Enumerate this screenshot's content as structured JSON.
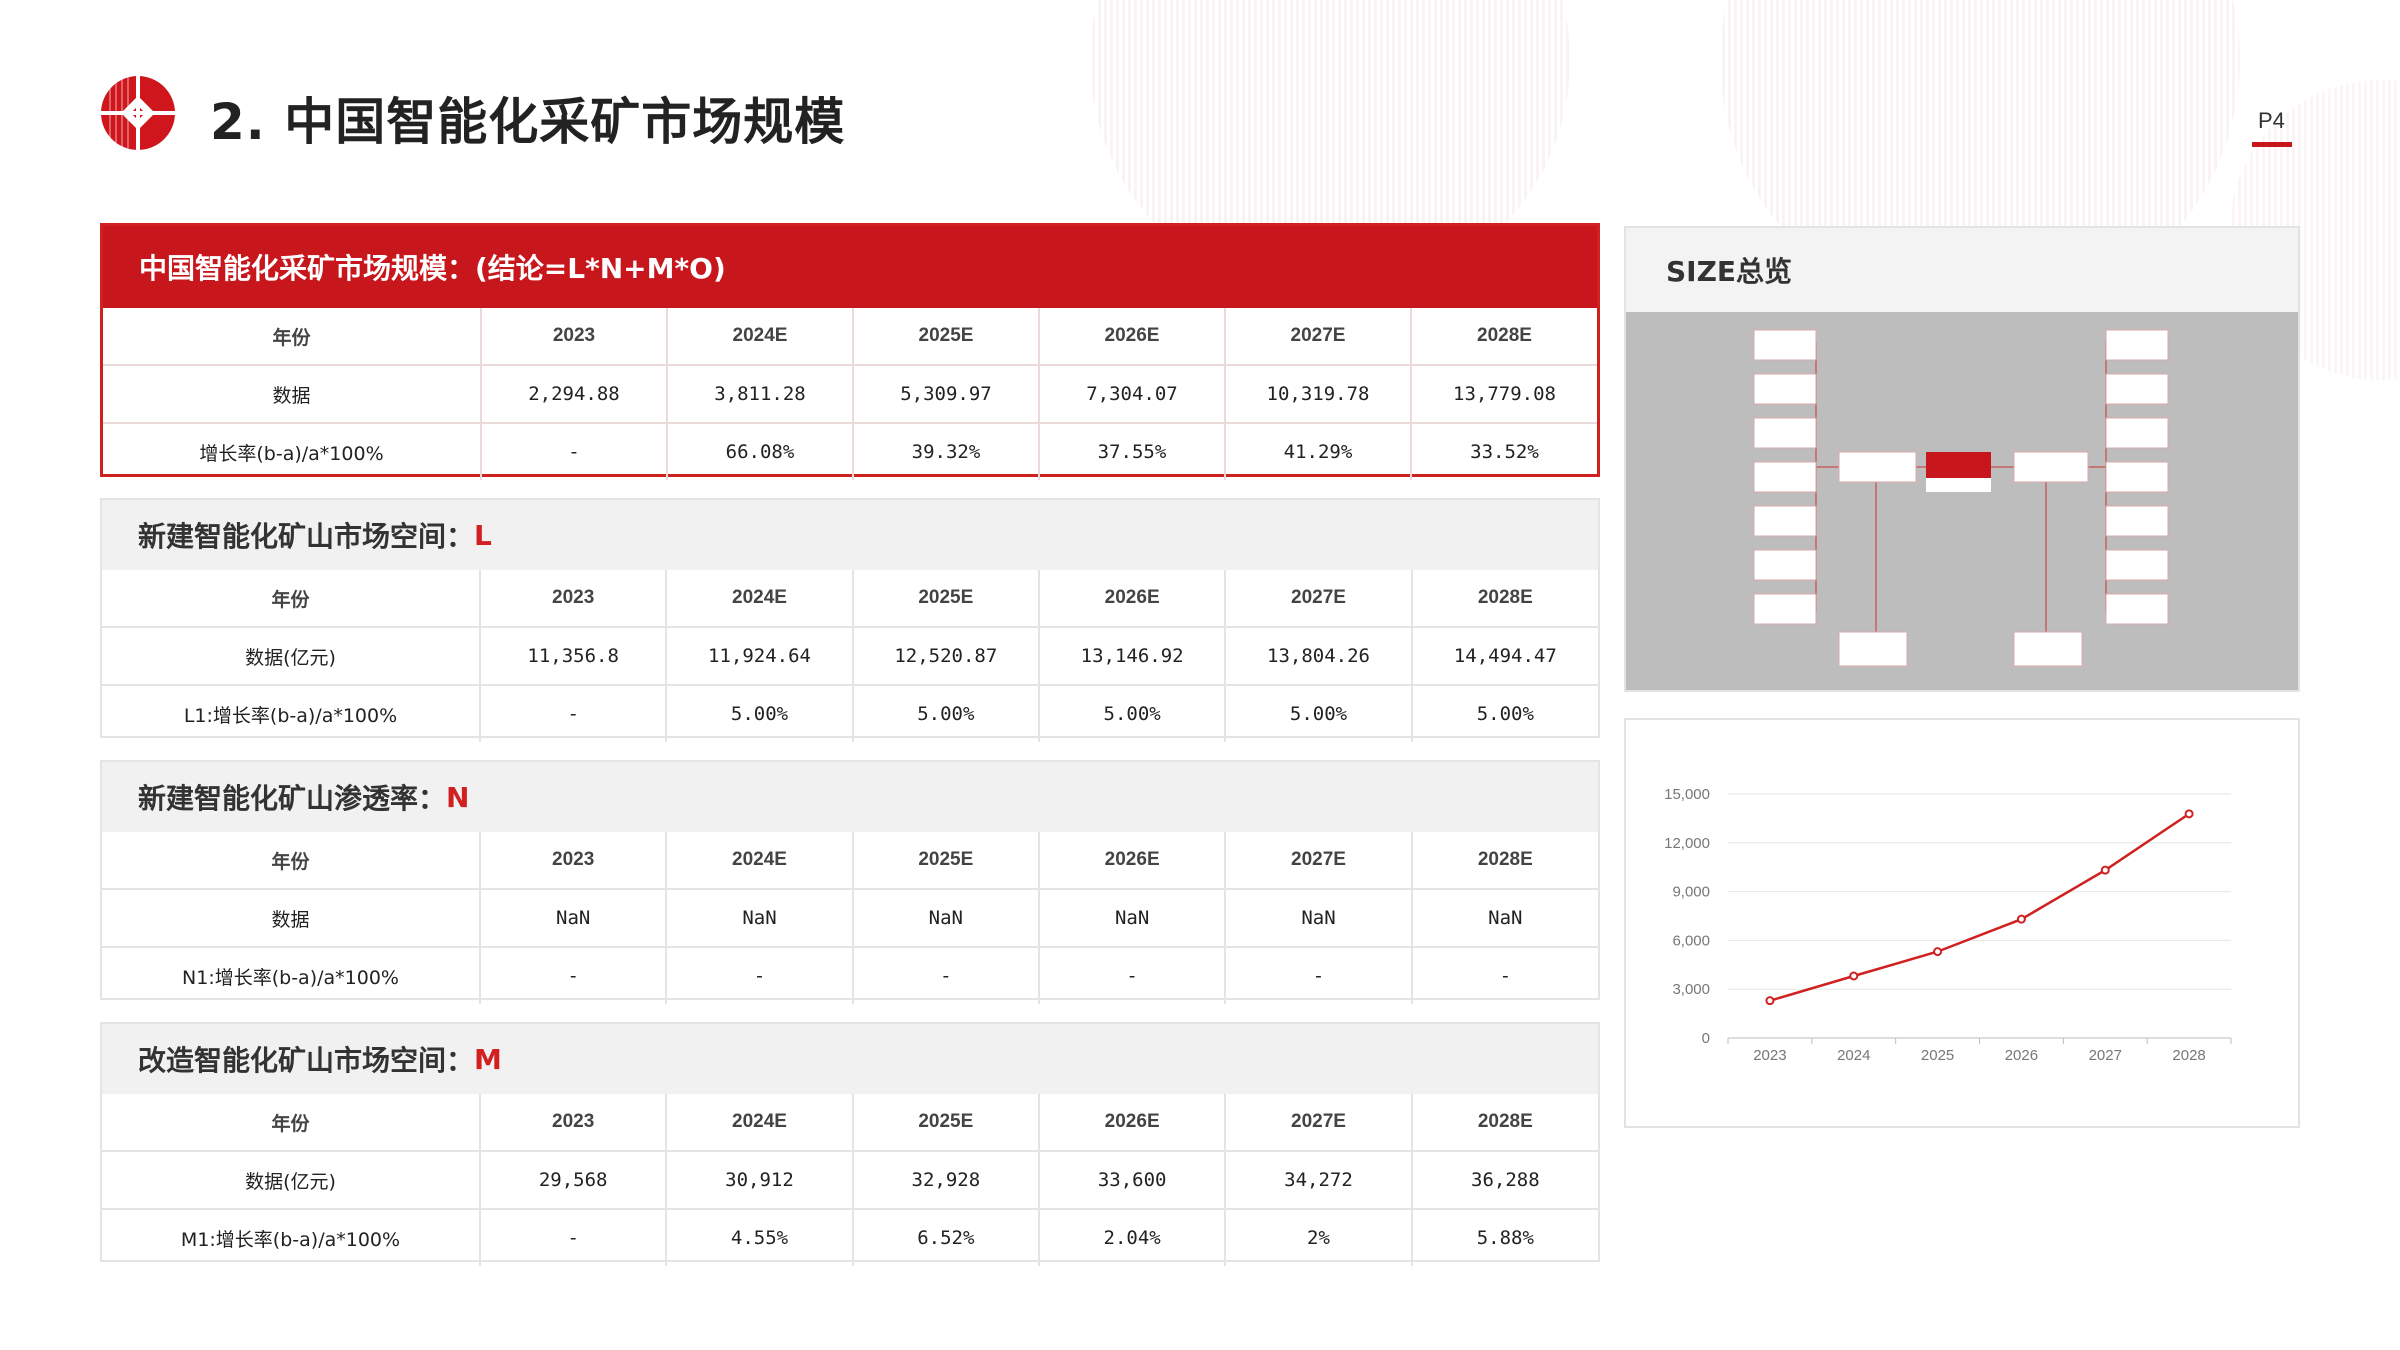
{
  "header": {
    "title": "2.  中国智能化采矿市场规模",
    "page": "P4"
  },
  "colors": {
    "accent": "#c8161d",
    "header_gray": "#f1f1f1",
    "tree_bg": "#bdbdbd"
  },
  "sections": [
    {
      "title": "中国智能化采矿市场规模：(结论=L*N+M*O)",
      "title_accent": "",
      "rows": [
        [
          "年份",
          "2023",
          "2024E",
          "2025E",
          "2026E",
          "2027E",
          "2028E"
        ],
        [
          "数据",
          "2,294.88",
          "3,811.28",
          "5,309.97",
          "7,304.07",
          "10,319.78",
          "13,779.08"
        ],
        [
          "增长率(b-a)/a*100%",
          "-",
          "66.08%",
          "39.32%",
          "37.55%",
          "41.29%",
          "33.52%"
        ]
      ]
    },
    {
      "title": "新建智能化矿山市场空间：",
      "title_accent": "L",
      "rows": [
        [
          "年份",
          "2023",
          "2024E",
          "2025E",
          "2026E",
          "2027E",
          "2028E"
        ],
        [
          "数据(亿元)",
          "11,356.8",
          "11,924.64",
          "12,520.87",
          "13,146.92",
          "13,804.26",
          "14,494.47"
        ],
        [
          "L1:增长率(b-a)/a*100%",
          "-",
          "5.00%",
          "5.00%",
          "5.00%",
          "5.00%",
          "5.00%"
        ]
      ]
    },
    {
      "title": "新建智能化矿山渗透率：",
      "title_accent": "N",
      "rows": [
        [
          "年份",
          "2023",
          "2024E",
          "2025E",
          "2026E",
          "2027E",
          "2028E"
        ],
        [
          "数据",
          "NaN",
          "NaN",
          "NaN",
          "NaN",
          "NaN",
          "NaN"
        ],
        [
          "N1:增长率(b-a)/a*100%",
          "-",
          "-",
          "-",
          "-",
          "-",
          "-"
        ]
      ]
    },
    {
      "title": "改造智能化矿山市场空间：",
      "title_accent": "M",
      "rows": [
        [
          "年份",
          "2023",
          "2024E",
          "2025E",
          "2026E",
          "2027E",
          "2028E"
        ],
        [
          "数据(亿元)",
          "29,568",
          "30,912",
          "32,928",
          "33,600",
          "34,272",
          "36,288"
        ],
        [
          "M1:增长率(b-a)/a*100%",
          "-",
          "4.55%",
          "6.52%",
          "2.04%",
          "2%",
          "5.88%"
        ]
      ]
    }
  ],
  "size_panel": {
    "title": "SIZE总览"
  },
  "chart_data": {
    "type": "line",
    "x": [
      "2023",
      "2024",
      "2025",
      "2026",
      "2027",
      "2028"
    ],
    "series": [
      {
        "values": [
          2294.88,
          3811.28,
          5309.97,
          7304.07,
          10319.78,
          13779.08
        ]
      }
    ],
    "yticks": [
      "0",
      "3,000",
      "6,000",
      "9,000",
      "12,000",
      "15,000"
    ],
    "ylim": [
      0,
      15000
    ],
    "grid": true,
    "color": "#d02020"
  }
}
